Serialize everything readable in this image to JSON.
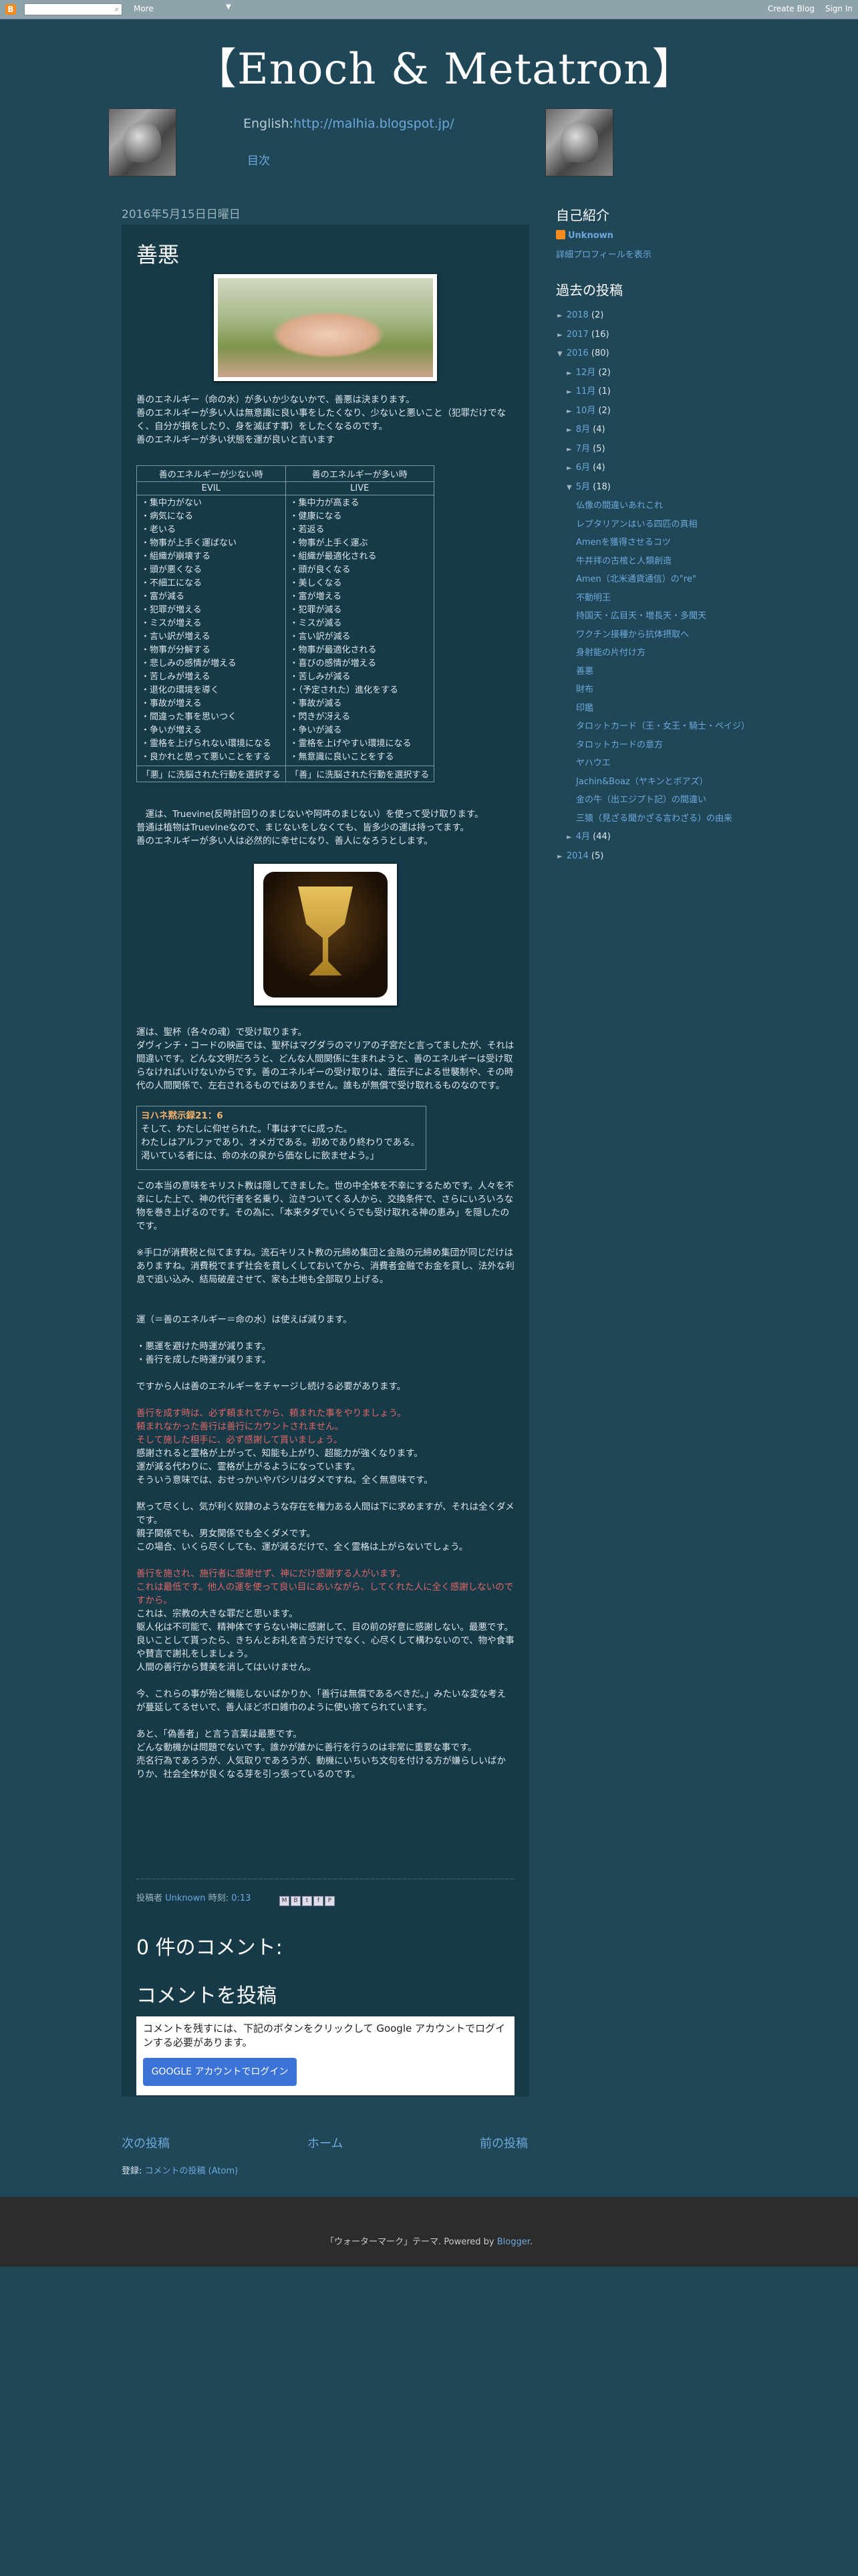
{
  "navbar": {
    "search_placeholder": "",
    "more_label": "More",
    "more_arrow": "▼",
    "create_blog": "Create Blog",
    "sign_in": "Sign In",
    "logo_glyph": "B",
    "search_icon": "⌕"
  },
  "header": {
    "title": "【Enoch & Metatron】",
    "english_prefix": "English:",
    "english_url": "http://malhia.blogspot.jp/",
    "index_label": "目次"
  },
  "post": {
    "date": "2016年5月15日日曜日",
    "title": "善悪",
    "intro": [
      "善のエネルギー（命の水）が多いか少ないかで、善悪は決まります。",
      "善のエネルギーが多い人は無意識に良い事をしたくなり、少ないと悪いこと（犯罪だけでなく、自分が損をしたり、身を滅ぼす事）をしたくなるのです。",
      "善のエネルギーが多い状態を運が良いと言います"
    ],
    "table": {
      "head_left": "善のエネルギーが少ない時",
      "head_right": "善のエネルギーが多い時",
      "sub_left": "EVIL",
      "sub_right": "LIVE",
      "left_items": [
        "・集中力がない",
        "・病気になる",
        "・老いる",
        "・物事が上手く運ばない",
        "・組織が崩壊する",
        "・頭が悪くなる",
        "・不細工になる",
        "・富が減る",
        "・犯罪が増える",
        "・ミスが増える",
        "・言い訳が増える",
        "・物事が分解する",
        "・悲しみの感情が増える",
        "・苦しみが増える",
        "・退化の環境を導く",
        "・事故が増える",
        "・間違った事を思いつく",
        "・争いが増える",
        "・霊格を上げられない環境になる",
        "・良かれと思って悪いことをする"
      ],
      "right_items": [
        "・集中力が高まる",
        "・健康になる",
        "・若返る",
        "・物事が上手く運ぶ",
        "・組織が最適化される",
        "・頭が良くなる",
        "・美しくなる",
        "・富が増える",
        "・犯罪が減る",
        "・ミスが減る",
        "・言い訳が減る",
        "・物事が最適化される",
        "・喜びの感情が増える",
        "・苦しみが減る",
        "・（予定された）進化をする",
        "・事故が減る",
        "・閃きが冴える",
        "・争いが減る",
        "・霊格を上げやすい環境になる",
        "・無意識に良いことをする"
      ],
      "foot_left": "「悪」に洗脳された行動を選択する",
      "foot_right": "「善」に洗脳された行動を選択する"
    },
    "luck_para": [
      "　運は、Truevine(反時計回りのまじないや阿吽のまじない）を使って受け取ります。",
      "普通は植物はTruevineなので、まじないをしなくても、皆多少の運は持ってます。",
      "善のエネルギーが多い人は必然的に幸せになり、善人になろうとします。"
    ],
    "grail_para": [
      "運は、聖杯（各々の魂）で受け取ります。",
      "ダヴィンチ・コードの映画では、聖杯はマグダラのマリアの子宮だと言ってましたが、それは間違いです。どんな文明だろうと、どんな人間関係に生まれようと、善のエネルギーは受け取らなければいけないからです。善のエネルギーの受け取りは、遺伝子による世襲制や、その時代の人間関係で、左右されるものではありません。誰もが無償で受け取れるものなのです。"
    ],
    "quote": {
      "ref": "ヨハネ黙示録21：6",
      "lines": [
        "そして、わたしに仰せられた。「事はすでに成った。",
        "わたしはアルファであり、オメガである。初めであり終わりである。",
        "渇いている者には、命の水の泉から価なしに飲ませよう。」"
      ]
    },
    "christ_para": "この本当の意味をキリスト教は隠してきました。世の中全体を不幸にするためです。人々を不幸にした上で、神の代行者を名乗り、泣きついてくる人から、交換条件で、さらにいろいろな物を巻き上げるのです。その為に、「本来タダでいくらでも受け取れる神の恵み」を隠したのです。",
    "note_para": "※手口が消費税と似てますね。流石キリスト教の元締め集団と金融の元締め集団が同じだけはありますね。消費税でまず社会を貧しくしておいてから、消費者金融でお金を貸し、法外な利息で追い込み、結局破産させて、家も土地も全部取り上げる。",
    "decrease_head": "運（＝善のエネルギー＝命の水）は使えば減ります。",
    "decrease_items": [
      "・悪運を避けた時運が減ります。",
      "・善行を成した時運が減ります。"
    ],
    "charge_line": "ですから人は善のエネルギーをチャージし続ける必要があります。",
    "charge_red": [
      "善行を成す時は、必ず頼まれてから、頼まれた事をやりましょう。",
      "頼まれなかった善行は善行にカウントされません。",
      "そして施した相手に、必ず感謝して貰いましょう。"
    ],
    "charge_after": [
      "感謝されると霊格が上がって、知能も上がり、超能力が強くなります。",
      "運が減る代わりに、霊格が上がるようになっています。",
      "そういう意味では、おせっかいやパシリはダメですね。全く無意味です。"
    ],
    "slave_para": [
      "黙って尽くし、気が利く奴隷のような存在を権力ある人間は下に求めますが、それは全くダメです。",
      "親子関係でも、男女関係でも全くダメです。",
      "この場合、いくら尽くしても、運が減るだけで、全く霊格は上がらないでしょう。"
    ],
    "help_red": [
      "善行を施され、施行者に感謝せず、神にだけ感謝する人がいます。",
      "これは最低です。他人の運を使って良い目にあいながら、してくれた人に全く感謝しないのですから。"
    ],
    "help_after": [
      "これは、宗教の大きな罪だと思います。",
      "躯人化は不可能で、精神体ですらない神に感謝して、目の前の好意に感謝しない。最悪です。",
      "良いことして貰ったら、きちんとお礼を言うだけでなく、心尽くして構わないので、物や食事や賛言で謝礼をしましょう。",
      "人間の善行から賛美を消してはいけません。"
    ],
    "now_para": "今、これらの事が殆ど機能しないばかりか、「善行は無償であるべきだ。」みたいな変な考えが蔓延してるせいで、善人ほどボロ雑巾のように使い捨てられています。",
    "last_para": [
      "あと、「偽善者」と言う言葉は最悪です。",
      "どんな動機かは問題でないです。誰かが誰かに善行を行うのは非常に重要な事です。",
      "売名行為であろうが、人気取りであろうが、動機にいちいち文句を付ける方が嫌らしいばかりか、社会全体が良くなる芽を引っ張っているのです。"
    ],
    "footer_by": "投稿者",
    "footer_author": "Unknown",
    "footer_time_label": "時刻:",
    "footer_time": "0:13",
    "share_icons": [
      "mail-icon",
      "blog-icon",
      "twitter-icon",
      "facebook-icon",
      "pinterest-icon"
    ],
    "share_glyphs": [
      "M",
      "B",
      "t",
      "f",
      "P"
    ],
    "comments_heading": "0 件のコメント:",
    "post_comment_heading": "コメントを投稿",
    "comment_notice": "コメントを残すには、下記のボタンをクリックして Google アカウントでログインする必要があります。",
    "login_button": "GOOGLE アカウントでログイン",
    "nav_older": "次の投稿",
    "nav_home": "ホーム",
    "nav_newer": "前の投稿",
    "subscribe_label": "登録:",
    "subscribe_link": "コメントの投稿 (Atom)"
  },
  "sidebar": {
    "profile_heading": "自己紹介",
    "profile_name": "Unknown",
    "profile_link": "詳細プロフィールを表示",
    "archive_heading": "過去の投稿",
    "archive": [
      {
        "level": "l1",
        "tog": "►",
        "label": "2018",
        "count": "(2)"
      },
      {
        "level": "l1",
        "tog": "►",
        "label": "2017",
        "count": "(16)"
      },
      {
        "level": "l1",
        "tog": "▼",
        "label": "2016",
        "count": "(80)"
      },
      {
        "level": "l2",
        "tog": "►",
        "label": "12月",
        "count": "(2)"
      },
      {
        "level": "l2",
        "tog": "►",
        "label": "11月",
        "count": "(1)"
      },
      {
        "level": "l2",
        "tog": "►",
        "label": "10月",
        "count": "(2)"
      },
      {
        "level": "l2",
        "tog": "►",
        "label": "8月",
        "count": "(4)"
      },
      {
        "level": "l2",
        "tog": "►",
        "label": "7月",
        "count": "(5)"
      },
      {
        "level": "l2",
        "tog": "►",
        "label": "6月",
        "count": "(4)"
      },
      {
        "level": "l2",
        "tog": "▼",
        "label": "5月",
        "count": "(18)"
      }
    ],
    "may_posts": [
      "仏像の間違いあれこれ",
      "レプタリアンはいる四匹の真相",
      "Amenを獲得させるコツ",
      "牛井拝の古棺と人類創造",
      "Amen（北米通貨通信）の\"re\"",
      "不動明王",
      "持国天・広目天・増長天・多聞天",
      "ワクチン接種から抗体摂取へ",
      "身射能の片付け方",
      "善悪",
      "財布",
      "印鑑",
      "タロットカード（王・女王・騎士・ペイジ）",
      "タロットカードの意方",
      "ヤハウエ",
      "Jachin&Boaz（ヤキンとボアズ）",
      "金の牛（出エジプト記）の間違い",
      "三猿（見ざる聞かざる言わざる）の由来"
    ],
    "after": [
      {
        "level": "l2",
        "tog": "►",
        "label": "4月",
        "count": "(44)"
      },
      {
        "level": "l1",
        "tog": "►",
        "label": "2014",
        "count": "(5)"
      }
    ]
  },
  "footer": {
    "prefix": "「ウォーターマーク」テーマ. Powered by ",
    "link": "Blogger",
    "suffix": "."
  }
}
